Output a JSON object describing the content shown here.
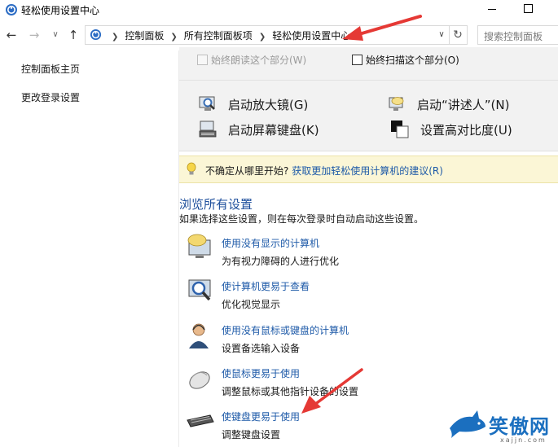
{
  "window": {
    "title": "轻松使用设置中心"
  },
  "address": {
    "crumbs": [
      "控制面板",
      "所有控制面板项",
      "轻松使用设置中心"
    ],
    "search_placeholder": "搜索控制面板"
  },
  "leftnav": {
    "items": [
      "控制面板主页",
      "更改登录设置"
    ]
  },
  "top_panel": {
    "checkbox_narrator": "始终朗读这个部分(W)",
    "checkbox_scan": "始终扫描这个部分(O)",
    "tools": {
      "magnifier": "启动放大镜(G)",
      "narrator": "启动“讲述人”(N)",
      "osk": "启动屏幕键盘(K)",
      "contrast": "设置高对比度(U)"
    }
  },
  "tip": {
    "prefix": "不确定从哪里开始?",
    "link": "获取更加轻松使用计算机的建议(R)"
  },
  "browse": {
    "title": "浏览所有设置",
    "subtitle": "如果选择这些设置，则在每次登录时自动启动这些设置。",
    "categories": [
      {
        "link": "使用没有显示的计算机",
        "desc": "为有视力障碍的人进行优化"
      },
      {
        "link": "使计算机更易于查看",
        "desc": "优化视觉显示"
      },
      {
        "link": "使用没有鼠标或键盘的计算机",
        "desc": "设置备选输入设备"
      },
      {
        "link": "使鼠标更易于使用",
        "desc": "调整鼠标或其他指针设备的设置"
      },
      {
        "link": "使键盘更易于使用",
        "desc": "调整键盘设置"
      }
    ]
  },
  "watermark": {
    "text": "笑傲网",
    "url": "xajjn.com"
  },
  "colors": {
    "link": "#1e5aa8",
    "heading": "#1e4f9c",
    "annotation": "#e53935",
    "tipbar": "#fbf6d6"
  }
}
